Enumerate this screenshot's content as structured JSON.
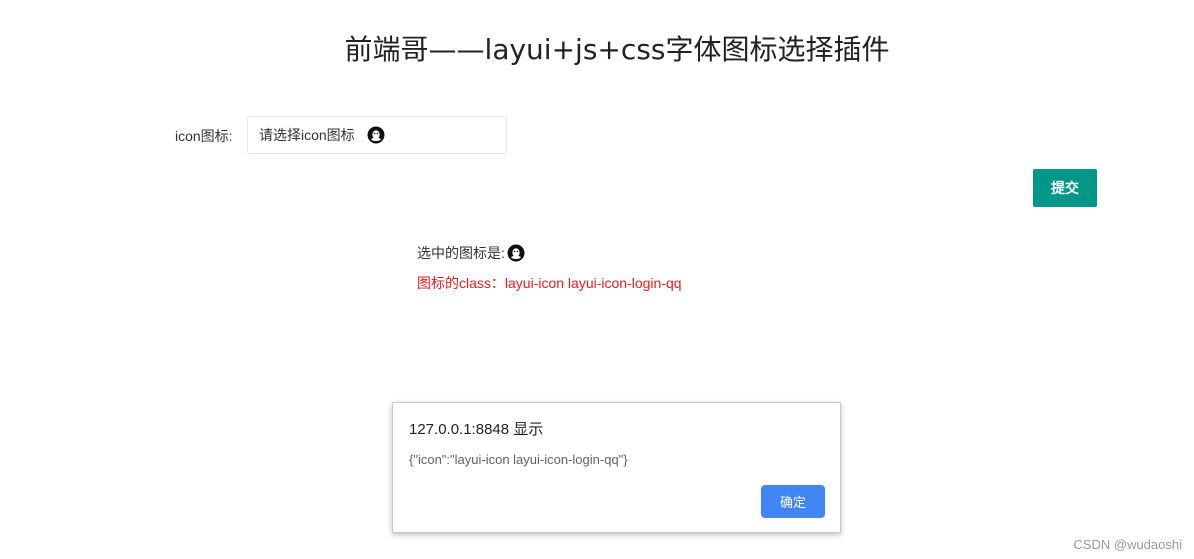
{
  "page": {
    "title": "前端哥——layui+js+css字体图标选择插件"
  },
  "form": {
    "icon_label": "icon图标:",
    "icon_placeholder": "请选择icon图标",
    "selected_icon": "qq-icon",
    "submit_label": "提交"
  },
  "result": {
    "selected_text": "选中的图标是:",
    "class_text": "图标的class：layui-icon layui-icon-login-qq"
  },
  "alert": {
    "title": "127.0.0.1:8848 显示",
    "message": "{\"icon\":\"layui-icon layui-icon-login-qq\"}",
    "ok_label": "确定"
  },
  "watermark": "CSDN @wudaoshi",
  "colors": {
    "submit": "#009688",
    "alert_ok": "#4285f4",
    "class_text": "#e02020"
  }
}
